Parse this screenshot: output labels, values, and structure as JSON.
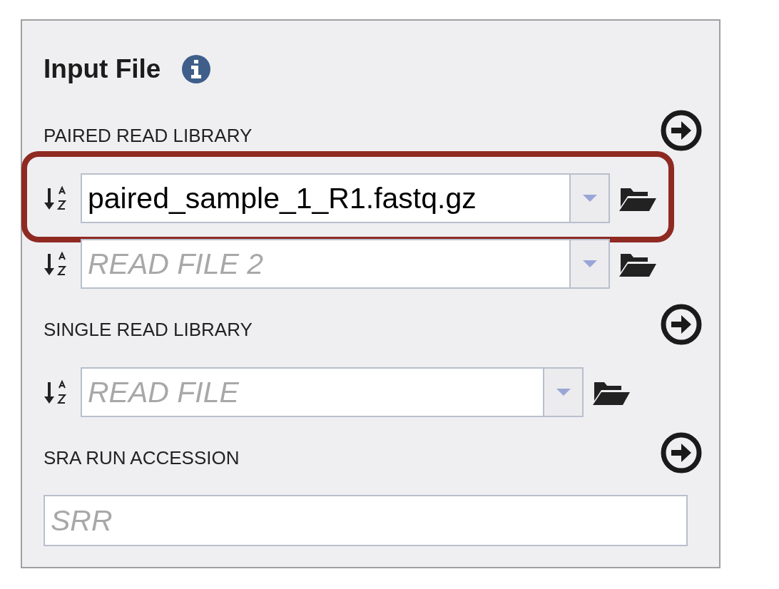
{
  "heading": {
    "title": "Input File"
  },
  "sections": [
    {
      "label": "PAIRED READ LIBRARY",
      "kind": "files",
      "fields": [
        {
          "value": "paired_sample_1_R1.fastq.gz",
          "highlighted": true
        },
        {
          "placeholder": "READ FILE 2",
          "highlighted": false
        }
      ]
    },
    {
      "label": "SINGLE READ LIBRARY",
      "kind": "files",
      "fields": [
        {
          "placeholder": "READ FILE",
          "highlighted": false
        }
      ]
    },
    {
      "label": "SRA RUN ACCESSION",
      "kind": "text",
      "fields": [
        {
          "placeholder": "SRR"
        }
      ]
    }
  ]
}
